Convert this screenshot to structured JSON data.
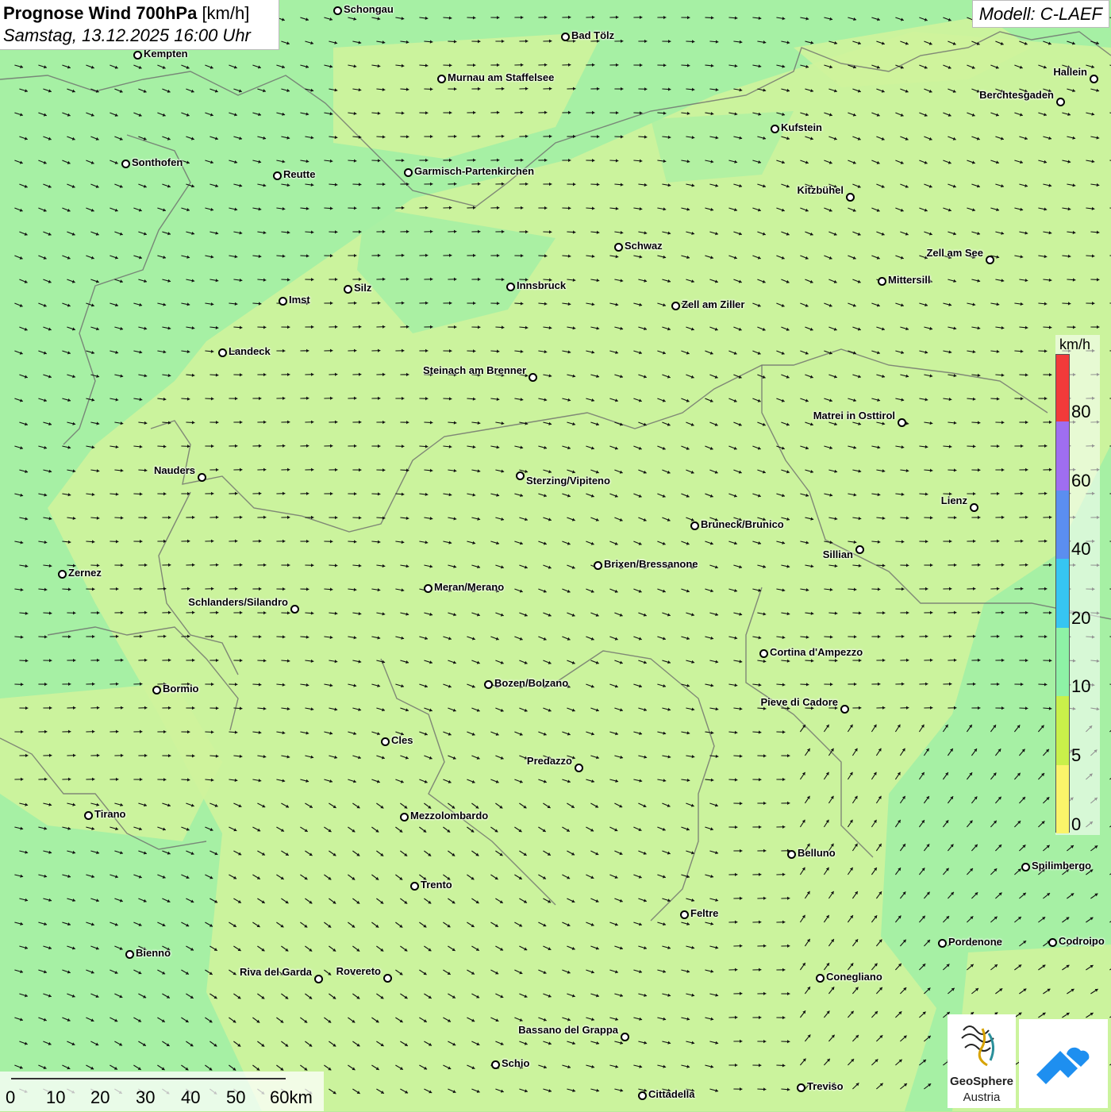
{
  "header": {
    "title_bold": "Prognose Wind 700hPa",
    "title_unit": "[km/h]",
    "subtitle": "Samstag, 13.12.2025 16:00 Uhr"
  },
  "model": {
    "label": "Modell: C-LAEF"
  },
  "legend": {
    "unit": "km/h",
    "labels": [
      "80",
      "60",
      "40",
      "20",
      "10",
      "5",
      "0"
    ],
    "colors": [
      "#f23a3a",
      "#9f6ef0",
      "#5b8ef0",
      "#36c5f2",
      "#8ef2a6",
      "#c9f04a",
      "#fbf46a"
    ]
  },
  "scale_bar": {
    "labels": [
      "0",
      "10",
      "20",
      "30",
      "40",
      "50",
      "60km"
    ]
  },
  "cities": [
    {
      "name": "Schongau"
    },
    {
      "name": "Bad Tölz"
    },
    {
      "name": "Kempten"
    },
    {
      "name": "Murnau am Staffelsee"
    },
    {
      "name": "Hallein"
    },
    {
      "name": "Berchtesgaden"
    },
    {
      "name": "Kufstein"
    },
    {
      "name": "Sonthofen"
    },
    {
      "name": "Reutte"
    },
    {
      "name": "Garmisch-Partenkirchen"
    },
    {
      "name": "Kitzbühel"
    },
    {
      "name": "Schwaz"
    },
    {
      "name": "Zell am See"
    },
    {
      "name": "Mittersill"
    },
    {
      "name": "Innsbruck"
    },
    {
      "name": "Silz"
    },
    {
      "name": "Imst"
    },
    {
      "name": "Zell am Ziller"
    },
    {
      "name": "Landeck"
    },
    {
      "name": "Steinach am Brenner"
    },
    {
      "name": "Matrei in Osttirol"
    },
    {
      "name": "Nauders"
    },
    {
      "name": "Sterzing/Vipiteno"
    },
    {
      "name": "Lienz"
    },
    {
      "name": "Bruneck/Brunico"
    },
    {
      "name": "Sillian"
    },
    {
      "name": "Brixen/Bressanone"
    },
    {
      "name": "Zernez"
    },
    {
      "name": "Meran/Merano"
    },
    {
      "name": "Schlanders/Silandro"
    },
    {
      "name": "Cortina d'Ampezzo"
    },
    {
      "name": "Bozen/Bolzano"
    },
    {
      "name": "Bormio"
    },
    {
      "name": "Pieve di Cadore"
    },
    {
      "name": "Cles"
    },
    {
      "name": "Predazzo"
    },
    {
      "name": "Tirano"
    },
    {
      "name": "Mezzolombardo"
    },
    {
      "name": "Belluno"
    },
    {
      "name": "Spilimbergo"
    },
    {
      "name": "Trento"
    },
    {
      "name": "Feltre"
    },
    {
      "name": "Pordenone"
    },
    {
      "name": "Codroipo"
    },
    {
      "name": "Bienno"
    },
    {
      "name": "Riva del Garda"
    },
    {
      "name": "Rovereto"
    },
    {
      "name": "Conegliano"
    },
    {
      "name": "Bassano del Grappa"
    },
    {
      "name": "Schio"
    },
    {
      "name": "Treviso"
    },
    {
      "name": "Cittadella"
    }
  ],
  "logos": {
    "geosphere_line1": "GeoSphere",
    "geosphere_line2": "Austria"
  }
}
